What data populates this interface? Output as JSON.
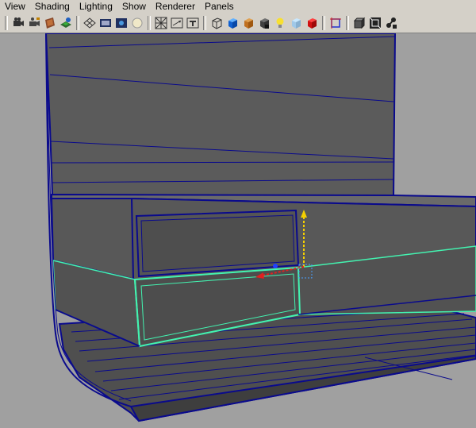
{
  "menu": {
    "items": [
      "View",
      "Shading",
      "Lighting",
      "Show",
      "Renderer",
      "Panels"
    ]
  },
  "toolbar": {
    "icons": [
      "camera-select-icon",
      "camera-attributes-icon",
      "bookmark-icon",
      "image-plane-icon",
      "grid-icon",
      "film-gate-icon",
      "resolution-gate-icon",
      "gate-mask-icon",
      "field-chart-icon",
      "safe-action-icon",
      "safe-title-icon",
      "wireframe-icon",
      "smooth-shade-icon",
      "textured-icon",
      "use-lights-icon",
      "shadows-icon",
      "xray-icon",
      "isolate-icon",
      "frame-all-icon",
      "frame-selection-icon",
      "show-manipulators-icon",
      "wire-on-shaded-icon",
      "backface-icon",
      "texture-icon"
    ]
  },
  "viewport": {
    "background_color": "#a0a0a0",
    "mesh_fill": "#595959",
    "mesh_edge_color": "#0a0a8c",
    "selection_color": "#43f3b0",
    "manipulator_y_color": "#f5d000",
    "manipulator_x_color": "#e02020",
    "manipulator_z_color": "#2040ff"
  }
}
